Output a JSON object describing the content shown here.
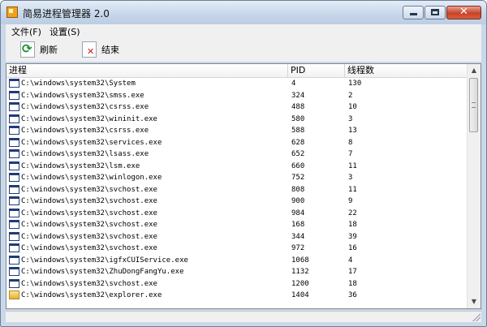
{
  "window": {
    "title": "简易进程管理器 2.0"
  },
  "menu": {
    "file": "文件(F)",
    "settings": "设置(S)"
  },
  "toolbar": {
    "refresh_label": "刷新",
    "end_label": "结束"
  },
  "columns": {
    "process": "进程",
    "pid": "PID",
    "threads": "线程数"
  },
  "processes": [
    {
      "path": "C:\\windows\\system32\\System",
      "pid": "4",
      "threads": "130",
      "icon": "window-icon"
    },
    {
      "path": "C:\\windows\\system32\\smss.exe",
      "pid": "324",
      "threads": "2",
      "icon": "window-icon"
    },
    {
      "path": "C:\\windows\\system32\\csrss.exe",
      "pid": "488",
      "threads": "10",
      "icon": "window-icon"
    },
    {
      "path": "C:\\windows\\system32\\wininit.exe",
      "pid": "580",
      "threads": "3",
      "icon": "window-icon"
    },
    {
      "path": "C:\\windows\\system32\\csrss.exe",
      "pid": "588",
      "threads": "13",
      "icon": "window-icon"
    },
    {
      "path": "C:\\windows\\system32\\services.exe",
      "pid": "628",
      "threads": "8",
      "icon": "window-icon"
    },
    {
      "path": "C:\\windows\\system32\\lsass.exe",
      "pid": "652",
      "threads": "7",
      "icon": "window-icon"
    },
    {
      "path": "C:\\windows\\system32\\lsm.exe",
      "pid": "660",
      "threads": "11",
      "icon": "window-icon"
    },
    {
      "path": "C:\\windows\\system32\\winlogon.exe",
      "pid": "752",
      "threads": "3",
      "icon": "window-icon"
    },
    {
      "path": "C:\\windows\\system32\\svchost.exe",
      "pid": "808",
      "threads": "11",
      "icon": "window-icon"
    },
    {
      "path": "C:\\windows\\system32\\svchost.exe",
      "pid": "900",
      "threads": "9",
      "icon": "window-icon"
    },
    {
      "path": "C:\\windows\\system32\\svchost.exe",
      "pid": "984",
      "threads": "22",
      "icon": "window-icon"
    },
    {
      "path": "C:\\windows\\system32\\svchost.exe",
      "pid": "168",
      "threads": "18",
      "icon": "window-icon"
    },
    {
      "path": "C:\\windows\\system32\\svchost.exe",
      "pid": "344",
      "threads": "39",
      "icon": "window-icon"
    },
    {
      "path": "C:\\windows\\system32\\svchost.exe",
      "pid": "972",
      "threads": "16",
      "icon": "window-icon"
    },
    {
      "path": "C:\\windows\\system32\\igfxCUIService.exe",
      "pid": "1068",
      "threads": "4",
      "icon": "window-icon"
    },
    {
      "path": "C:\\windows\\system32\\ZhuDongFangYu.exe",
      "pid": "1132",
      "threads": "17",
      "icon": "window-icon"
    },
    {
      "path": "C:\\windows\\system32\\svchost.exe",
      "pid": "1200",
      "threads": "18",
      "icon": "window-icon"
    },
    {
      "path": "C:\\windows\\system32\\explorer.exe",
      "pid": "1404",
      "threads": "36",
      "icon": "explorer-icon"
    }
  ]
}
